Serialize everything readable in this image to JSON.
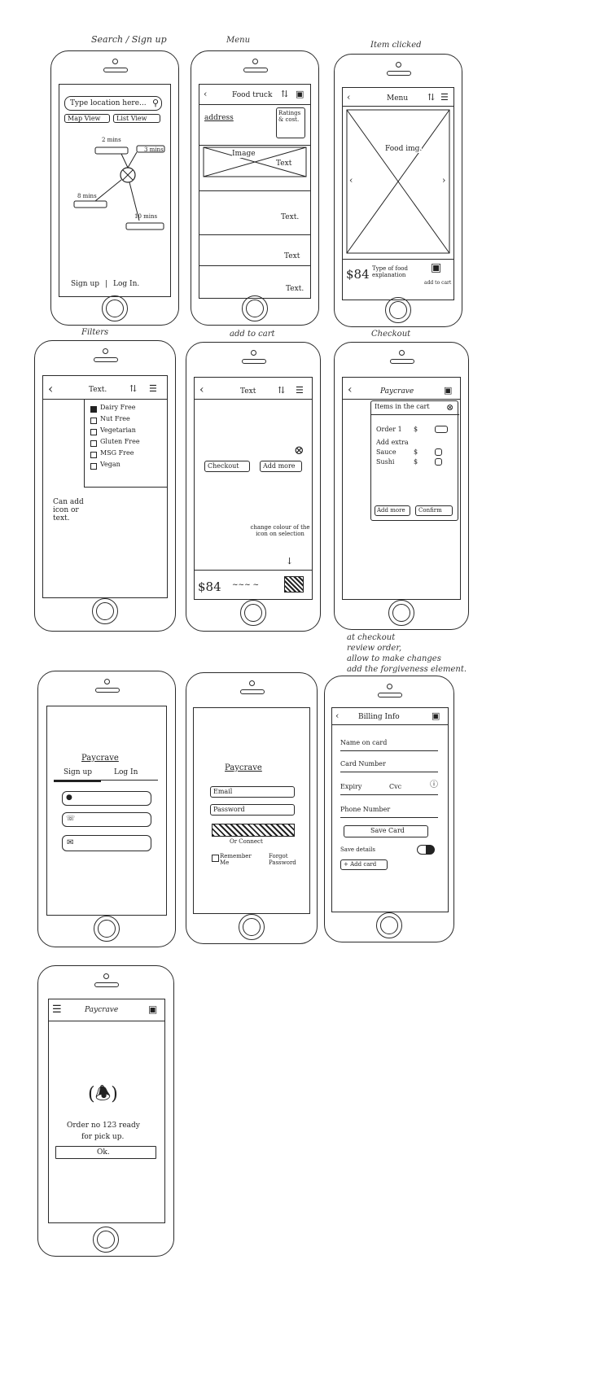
{
  "labels": {
    "search": "Search / Sign up",
    "menu": "Menu",
    "item_clicked": "Item clicked",
    "filters": "Filters",
    "add_to_cart": "add to cart",
    "checkout": "Checkout",
    "checkout_note_1": "at checkout",
    "checkout_note_2": "review order,",
    "checkout_note_3": "allow to make changes",
    "checkout_note_4": "add the forgiveness element."
  },
  "screen1": {
    "search_placeholder": "Type location here...",
    "map_view": "Map View",
    "list_view": "List View",
    "dist1": "2 mins",
    "dist2": "3 mins",
    "dist3": "8 mins",
    "dist4": "10 mins",
    "sign_up": "Sign up",
    "log_in": "Log In."
  },
  "screen2": {
    "title": "Food truck",
    "address": "address",
    "ratings": "Ratings & cost.",
    "image": "Image",
    "text1": "Text",
    "text2": "Text.",
    "text3": "Text",
    "text4": "Text."
  },
  "screen3": {
    "title": "Menu",
    "food_img": "Food img.",
    "price": "$84",
    "desc": "Type of food explanation",
    "add_to_cart": "add to cart"
  },
  "screen4": {
    "title": "Text.",
    "options": [
      "Dairy Free",
      "Nut Free",
      "Vegetarian",
      "Gluten Free",
      "MSG Free",
      "Vegan"
    ],
    "note": "Can add icon or text."
  },
  "screen5": {
    "title": "Text",
    "checkout_btn": "Checkout",
    "add_more_btn": "Add more",
    "note": "change colour of the icon on selection",
    "price": "$84"
  },
  "screen6": {
    "title": "Paycrave",
    "items_header": "Items in the cart",
    "order": "Order 1",
    "currency": "$",
    "add_extra": "Add extra",
    "extra1": "Sauce",
    "extra2": "Sushi",
    "add_more_btn": "Add more",
    "confirm_btn": "Confirm"
  },
  "screen7": {
    "title": "Paycrave",
    "tab_signup": "Sign up",
    "tab_login": "Log In"
  },
  "screen8": {
    "title": "Paycrave",
    "email": "Email",
    "password": "Password",
    "or": "Or Connect",
    "remember": "Remember Me",
    "forgot": "Forgot Password"
  },
  "screen9": {
    "title": "Billing Info",
    "name_on_card": "Name on card",
    "card_number": "Card Number",
    "expiry": "Expiry",
    "cvc": "Cvc",
    "phone": "Phone Number",
    "save_card": "Save Card",
    "save_details": "Save details",
    "add_card": "+ Add card"
  },
  "screen10": {
    "title": "Paycrave",
    "message_1": "Order no 123 ready",
    "message_2": "for pick up.",
    "ok": "Ok."
  }
}
